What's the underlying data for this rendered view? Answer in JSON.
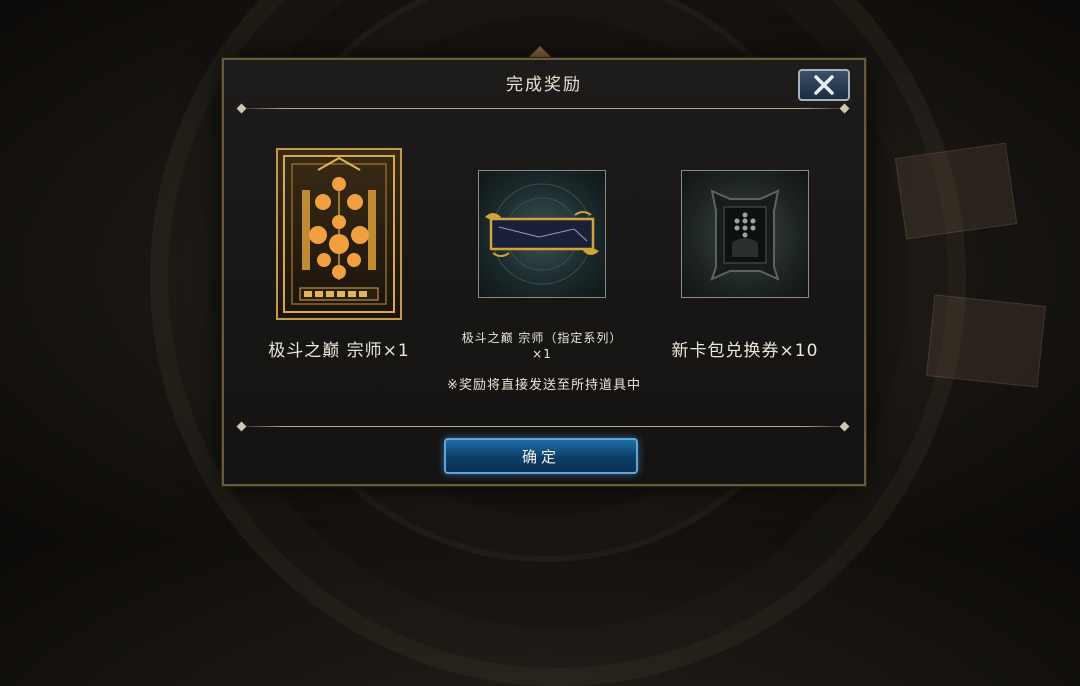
{
  "dialog": {
    "title": "完成奖励",
    "close_icon": "close-x-icon",
    "rewards": [
      {
        "name": "极斗之巅 宗师×1",
        "icon": "golden-card-back-icon"
      },
      {
        "name_line1": "极斗之巅 宗师（指定系列）",
        "name_line2": "×1",
        "icon": "ornate-title-frame-icon"
      },
      {
        "name": "新卡包兑换券×10",
        "icon": "card-pack-ticket-icon"
      }
    ],
    "notice": "※奖励将直接发送至所持道具中",
    "confirm_label": "确定"
  },
  "colors": {
    "gold_border": "#c49a4a",
    "confirm_blue": "#1f6fa6",
    "text": "#ece6d8"
  }
}
